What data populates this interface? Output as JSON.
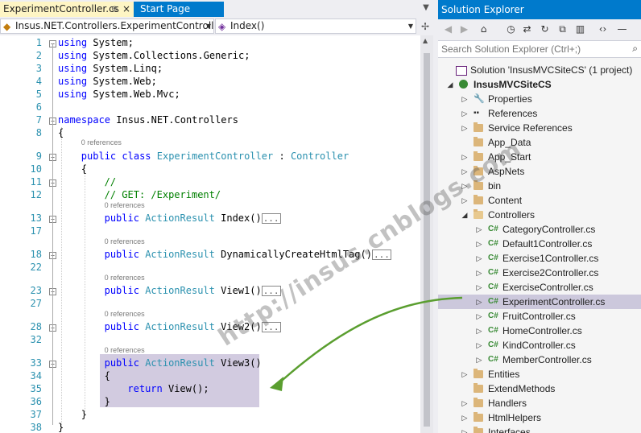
{
  "tabs": {
    "active": {
      "label": "ExperimentController.cs",
      "pin": "⊕",
      "close": "×"
    },
    "start": {
      "label": "Start Page"
    }
  },
  "navbar": {
    "class_combo": "Insus.NET.Controllers.ExperimentController",
    "method_combo": "Index()"
  },
  "editor": {
    "lines": [
      {
        "n": "1",
        "code": "using System;"
      },
      {
        "n": "2",
        "code": "using System.Collections.Generic;"
      },
      {
        "n": "3",
        "code": "using System.Linq;"
      },
      {
        "n": "4",
        "code": "using System.Web;"
      },
      {
        "n": "5",
        "code": "using System.Web.Mvc;"
      },
      {
        "n": "6",
        "code": ""
      },
      {
        "n": "7",
        "code": "namespace Insus.NET.Controllers"
      },
      {
        "n": "8",
        "code": "{"
      },
      {
        "n": "9",
        "code": "public class ExperimentController : Controller",
        "ref": "0 references"
      },
      {
        "n": "10",
        "code": "{"
      },
      {
        "n": "11",
        "code": "//"
      },
      {
        "n": "12",
        "code": "// GET: /Experiment/"
      },
      {
        "n": "13",
        "code": "public ActionResult Index()",
        "ref": "0 references",
        "collapsed": "..."
      },
      {
        "n": "17",
        "code": ""
      },
      {
        "n": "18",
        "code": "public ActionResult DynamicallyCreateHtmlTag()",
        "ref": "0 references",
        "collapsed": "..."
      },
      {
        "n": "22",
        "code": ""
      },
      {
        "n": "23",
        "code": "public ActionResult View1()",
        "ref": "0 references",
        "collapsed": "..."
      },
      {
        "n": "27",
        "code": ""
      },
      {
        "n": "28",
        "code": "public ActionResult View2()",
        "ref": "0 references",
        "collapsed": "..."
      },
      {
        "n": "32",
        "code": ""
      },
      {
        "n": "33",
        "code": "public ActionResult View3()",
        "ref": "0 references"
      },
      {
        "n": "34",
        "code": "{"
      },
      {
        "n": "35",
        "code": "return View();"
      },
      {
        "n": "36",
        "code": "}"
      },
      {
        "n": "37",
        "code": "}"
      },
      {
        "n": "38",
        "code": "}"
      }
    ]
  },
  "solution_explorer": {
    "title": "Solution Explorer",
    "search_placeholder": "Search Solution Explorer (Ctrl+;)",
    "toolbar_icons": [
      "back-icon",
      "forward-icon",
      "home-icon",
      "history-icon",
      "sync-icon",
      "refresh-icon",
      "collapse-all-icon",
      "show-all-files-icon",
      "code-view-icon",
      "settings-icon"
    ],
    "tree": [
      {
        "label": "Solution 'InsusMVCSiteCS' (1 project)",
        "level": 0,
        "expander": "",
        "icon": "solution"
      },
      {
        "label": "InsusMVCSiteCS",
        "level": 1,
        "expander": "◢",
        "icon": "web-project",
        "bold": true
      },
      {
        "label": "Properties",
        "level": 2,
        "expander": "▷",
        "icon": "wrench"
      },
      {
        "label": "References",
        "level": 2,
        "expander": "▷",
        "icon": "references"
      },
      {
        "label": "Service References",
        "level": 2,
        "expander": "▷",
        "icon": "folder"
      },
      {
        "label": "App_Data",
        "level": 2,
        "expander": "",
        "icon": "folder"
      },
      {
        "label": "App_Start",
        "level": 2,
        "expander": "▷",
        "icon": "folder"
      },
      {
        "label": "AspNets",
        "level": 2,
        "expander": "▷",
        "icon": "folder"
      },
      {
        "label": "bin",
        "level": 2,
        "expander": "▷",
        "icon": "folder"
      },
      {
        "label": "Content",
        "level": 2,
        "expander": "▷",
        "icon": "folder"
      },
      {
        "label": "Controllers",
        "level": 2,
        "expander": "◢",
        "icon": "folder-open"
      },
      {
        "label": "CategoryController.cs",
        "level": 3,
        "expander": "▷",
        "icon": "cs"
      },
      {
        "label": "Default1Controller.cs",
        "level": 3,
        "expander": "▷",
        "icon": "cs"
      },
      {
        "label": "Exercise1Controller.cs",
        "level": 3,
        "expander": "▷",
        "icon": "cs"
      },
      {
        "label": "Exercise2Controller.cs",
        "level": 3,
        "expander": "▷",
        "icon": "cs"
      },
      {
        "label": "ExerciseController.cs",
        "level": 3,
        "expander": "▷",
        "icon": "cs"
      },
      {
        "label": "ExperimentController.cs",
        "level": 3,
        "expander": "▷",
        "icon": "cs",
        "selected": true
      },
      {
        "label": "FruitController.cs",
        "level": 3,
        "expander": "▷",
        "icon": "cs"
      },
      {
        "label": "HomeController.cs",
        "level": 3,
        "expander": "▷",
        "icon": "cs"
      },
      {
        "label": "KindController.cs",
        "level": 3,
        "expander": "▷",
        "icon": "cs"
      },
      {
        "label": "MemberController.cs",
        "level": 3,
        "expander": "▷",
        "icon": "cs"
      },
      {
        "label": "Entities",
        "level": 2,
        "expander": "▷",
        "icon": "folder"
      },
      {
        "label": "ExtendMethods",
        "level": 2,
        "expander": "",
        "icon": "folder"
      },
      {
        "label": "Handlers",
        "level": 2,
        "expander": "▷",
        "icon": "folder"
      },
      {
        "label": "HtmlHelpers",
        "level": 2,
        "expander": "▷",
        "icon": "folder"
      },
      {
        "label": "Interfaces",
        "level": 2,
        "expander": "▷",
        "icon": "folder"
      }
    ]
  },
  "watermark": "http://insus.cnblogs.com",
  "colors": {
    "accent": "#007acc",
    "keyword": "#0000ff",
    "type": "#2b91af",
    "comment": "#008000",
    "selection": "#d2cbe0",
    "arrow": "#5a9e2f"
  }
}
